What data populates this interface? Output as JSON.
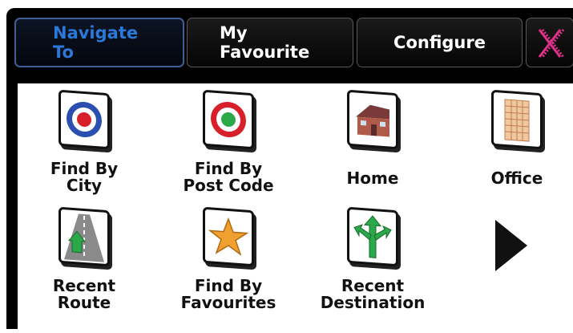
{
  "tabs": [
    {
      "label_line1": "Navigate",
      "label_line2": "To",
      "active": true
    },
    {
      "label_line1": "My",
      "label_line2": "Favourite",
      "active": false
    },
    {
      "label_line1": "Configure",
      "label_line2": "",
      "active": false
    }
  ],
  "close_icon": "x-close-icon",
  "colors": {
    "active_tab_text": "#2a78d8",
    "close": "#e0308a",
    "accent_blue": "#2a4fb0",
    "accent_red": "#d8202a"
  },
  "items": [
    {
      "name": "find-by-city",
      "icon": "target-blue-icon",
      "line1": "Find By",
      "line2": "City"
    },
    {
      "name": "find-by-post-code",
      "icon": "target-green-icon",
      "line1": "Find By",
      "line2": "Post Code"
    },
    {
      "name": "home",
      "icon": "house-icon",
      "line1": "Home",
      "line2": ""
    },
    {
      "name": "office",
      "icon": "office-building-icon",
      "line1": "Office",
      "line2": ""
    },
    {
      "name": "recent-route",
      "icon": "road-icon",
      "line1": "Recent",
      "line2": "Route"
    },
    {
      "name": "find-by-favourites",
      "icon": "star-icon",
      "line1": "Find By",
      "line2": "Favourites"
    },
    {
      "name": "recent-destination",
      "icon": "split-arrow-icon",
      "line1": "Recent",
      "line2": "Destination"
    }
  ],
  "next_page_icon": "next-page-arrow-icon"
}
